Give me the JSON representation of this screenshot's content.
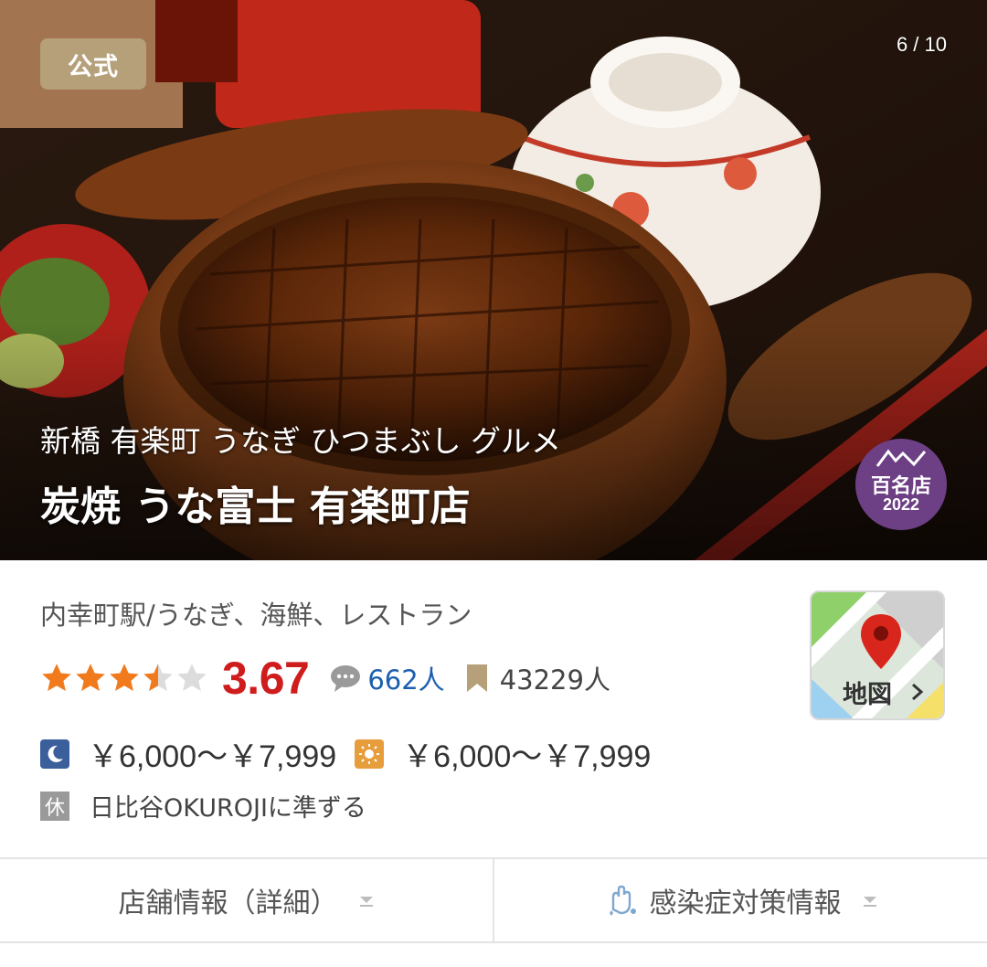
{
  "hero": {
    "official_badge": "公式",
    "photo_counter": "6 / 10",
    "subtitle": "新橋 有楽町 うなぎ ひつまぶし グルメ",
    "restaurant_name": "炭焼 うな富士 有楽町店",
    "award": {
      "label": "百名店",
      "year": "2022"
    }
  },
  "info": {
    "station_genre": "内幸町駅/うなぎ、海鮮、レストラン",
    "rating": {
      "stars": 3.5,
      "max_stars": 5,
      "score": "3.67"
    },
    "reviews": "662人",
    "bookmarks": "43229人",
    "dinner_price": "￥6,000～￥7,999",
    "lunch_price": "￥6,000～￥7,999",
    "closed_icon_text": "休",
    "closed_days": "日比谷OKUROJIに準ずる"
  },
  "map_button": {
    "label": "地図"
  },
  "tabs": [
    {
      "label": "店舗情報（詳細）"
    },
    {
      "label": "感染症対策情報"
    }
  ],
  "colors": {
    "star": "#f07a1c",
    "score": "#cf1d1d",
    "review_link": "#1b5fae",
    "award_bg": "#6d3f84",
    "official_badge_bg": "#b5a07a",
    "map_pin": "#d9261c"
  },
  "icons": [
    "review-bubble-icon",
    "bookmark-icon",
    "moon-icon",
    "sun-icon",
    "map-pin-icon",
    "chevron-right-icon",
    "chevron-down-icon",
    "sanitize-hand-icon",
    "mountain-icon"
  ]
}
